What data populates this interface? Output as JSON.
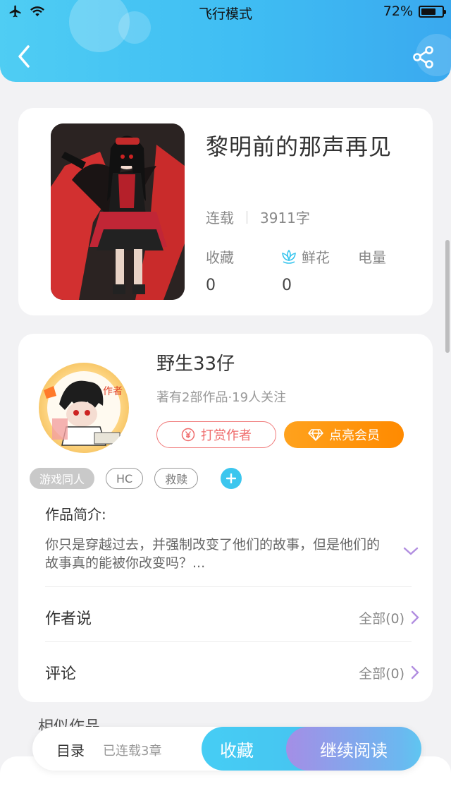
{
  "status_bar": {
    "mode": "飞行模式",
    "battery": "72%",
    "battery_level": 0.72
  },
  "nav": {
    "back_icon": "chevron-left-icon",
    "share_icon": "share-icon"
  },
  "book": {
    "title": "黎明前的那声再见",
    "status": "连载",
    "word_count": "3911字",
    "stats": {
      "favorites_label": "收藏",
      "favorites_value": "0",
      "flowers_label": "鲜花",
      "flowers_value": "0",
      "power_label": "电量"
    }
  },
  "author": {
    "name": "野生33仔",
    "info": "著有2部作品·19人关注",
    "reward_label": "打赏作者",
    "vip_label": "点亮会员",
    "avatar_badge": "作者"
  },
  "tags": [
    "游戏同人",
    "HC",
    "救赎"
  ],
  "intro": {
    "title": "作品简介:",
    "text": "你只是穿越过去，并强制改变了他们的故事，但是他们的故事真的能被你改变吗？..."
  },
  "rows": {
    "author_says_label": "作者说",
    "author_says_value": "全部(0)",
    "comments_label": "评论",
    "comments_value": "全部(0)"
  },
  "similar": {
    "title": "相似作品"
  },
  "bottom_bar": {
    "toc_label": "目录",
    "chapters_label": "已连载3章",
    "collect_label": "收藏",
    "read_label": "继续阅读"
  },
  "colors": {
    "header_blue": "#3fbdf3",
    "accent_purple": "#b18ee0",
    "reward_red": "#ef6b6b",
    "vip_orange": "#ff8a00"
  }
}
